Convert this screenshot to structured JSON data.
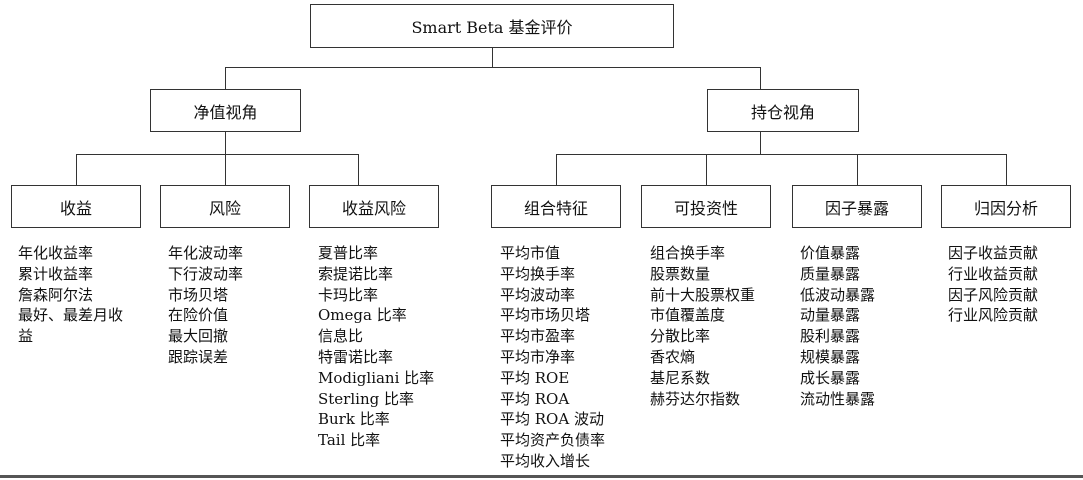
{
  "root": {
    "label": "Smart Beta 基金评价"
  },
  "perspectives": [
    {
      "label": "净值视角"
    },
    {
      "label": "持仓视角"
    }
  ],
  "categories": [
    {
      "label": "收益",
      "items": [
        "年化收益率",
        "累计收益率",
        "詹森阿尔法",
        "最好、最差月收益"
      ]
    },
    {
      "label": "风险",
      "items": [
        "年化波动率",
        "下行波动率",
        "市场贝塔",
        "在险价值",
        "最大回撤",
        "跟踪误差"
      ]
    },
    {
      "label": "收益风险",
      "items": [
        "夏普比率",
        "索提诺比率",
        "卡玛比率",
        "Omega 比率",
        "信息比",
        "特雷诺比率",
        "Modigliani 比率",
        "Sterling 比率",
        "Burk 比率",
        "Tail 比率"
      ]
    },
    {
      "label": "组合特征",
      "items": [
        "平均市值",
        "平均换手率",
        "平均波动率",
        "平均市场贝塔",
        "平均市盈率",
        "平均市净率",
        "平均 ROE",
        "平均 ROA",
        "平均 ROA 波动",
        "平均资产负债率",
        "平均收入增长"
      ]
    },
    {
      "label": "可投资性",
      "items": [
        "组合换手率",
        "股票数量",
        "前十大股票权重",
        "市值覆盖度",
        "分散比率",
        "香农熵",
        "基尼系数",
        "赫芬达尔指数"
      ]
    },
    {
      "label": "因子暴露",
      "items": [
        "价值暴露",
        "质量暴露",
        "低波动暴露",
        "动量暴露",
        "股利暴露",
        "规模暴露",
        "成长暴露",
        "流动性暴露"
      ]
    },
    {
      "label": "归因分析",
      "items": [
        "因子收益贡献",
        "行业收益贡献",
        "因子风险贡献",
        "行业风险贡献"
      ]
    }
  ]
}
